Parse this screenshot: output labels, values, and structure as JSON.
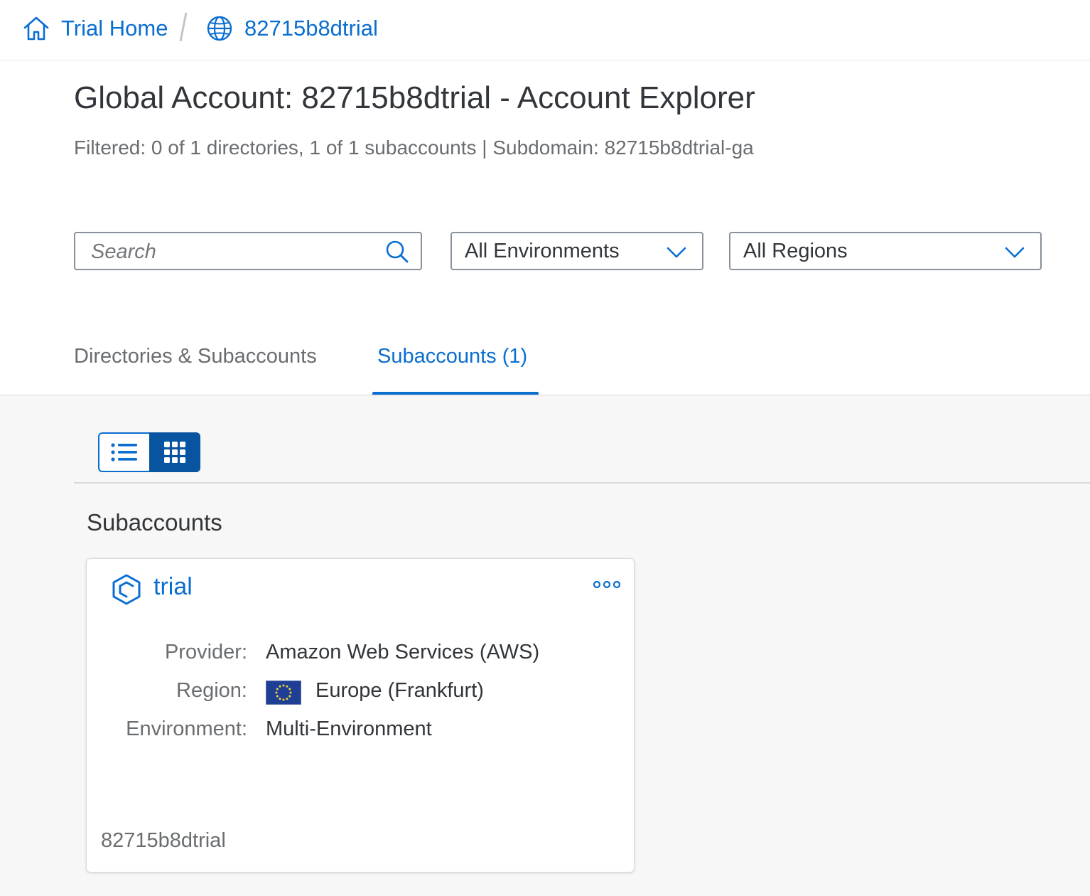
{
  "breadcrumb": {
    "home_label": "Trial Home",
    "account_label": "82715b8dtrial"
  },
  "header": {
    "title": "Global Account: 82715b8dtrial - Account Explorer",
    "subtitle": "Filtered: 0 of 1 directories, 1 of 1 subaccounts | Subdomain: 82715b8dtrial-ga"
  },
  "filters": {
    "search_placeholder": "Search",
    "environment_selected": "All Environments",
    "region_selected": "All Regions"
  },
  "tabs": [
    {
      "label": "Directories & Subaccounts",
      "active": false
    },
    {
      "label": "Subaccounts (1)",
      "active": true
    }
  ],
  "view_toggle": {
    "selected": "grid",
    "icons": [
      "list-icon",
      "grid-icon"
    ]
  },
  "section": {
    "title": "Subaccounts"
  },
  "subaccount_card": {
    "name": "trial",
    "properties": [
      {
        "label": "Provider:",
        "value": "Amazon Web Services (AWS)"
      },
      {
        "label": "Region:",
        "value": "Europe (Frankfurt)",
        "icon": "eu-flag-icon"
      },
      {
        "label": "Environment:",
        "value": "Multi-Environment"
      }
    ],
    "footer": "82715b8dtrial"
  },
  "colors": {
    "accent": "#0a6ed1",
    "accent_dark": "#0854a0",
    "text": "#32363a",
    "muted_text": "#6a6d70",
    "background": "#f7f7f7"
  }
}
